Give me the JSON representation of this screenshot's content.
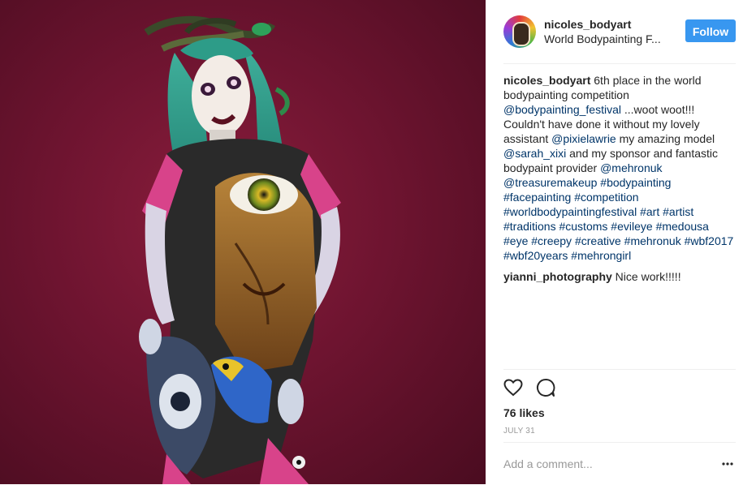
{
  "post": {
    "image_alt": "Bodypainted model with Medusa-style snake hair"
  },
  "header": {
    "username": "nicoles_bodyart",
    "location": "World Bodypainting F...",
    "follow_label": "Follow",
    "avatar_icon": "profile-avatar"
  },
  "comments": [
    {
      "user": "nicoles_bodyart",
      "segments": [
        {
          "text": " 6th place in the world bodypainting competition ",
          "type": "text"
        },
        {
          "text": "@bodypainting_festival",
          "type": "mention"
        },
        {
          "text": " ...woot woot!!! Couldn't have done it without my lovely assistant ",
          "type": "text"
        },
        {
          "text": "@pixielawrie",
          "type": "mention"
        },
        {
          "text": " my amazing model ",
          "type": "text"
        },
        {
          "text": "@sarah_xixi",
          "type": "mention"
        },
        {
          "text": " and my sponsor and fantastic bodypaint provider ",
          "type": "text"
        },
        {
          "text": "@mehronuk",
          "type": "mention"
        },
        {
          "text": " ",
          "type": "text"
        },
        {
          "text": "@treasuremakeup",
          "type": "mention"
        },
        {
          "text": " ",
          "type": "text"
        },
        {
          "text": "#bodypainting",
          "type": "mention"
        },
        {
          "text": " ",
          "type": "text"
        },
        {
          "text": "#facepainting",
          "type": "mention"
        },
        {
          "text": " ",
          "type": "text"
        },
        {
          "text": "#competition",
          "type": "mention"
        },
        {
          "text": " ",
          "type": "text"
        },
        {
          "text": "#worldbodypaintingfestival",
          "type": "mention"
        },
        {
          "text": " ",
          "type": "text"
        },
        {
          "text": "#art",
          "type": "mention"
        },
        {
          "text": " ",
          "type": "text"
        },
        {
          "text": "#artist",
          "type": "mention"
        },
        {
          "text": " ",
          "type": "text"
        },
        {
          "text": "#traditions",
          "type": "mention"
        },
        {
          "text": " ",
          "type": "text"
        },
        {
          "text": "#customs",
          "type": "mention"
        },
        {
          "text": " ",
          "type": "text"
        },
        {
          "text": "#evileye",
          "type": "mention"
        },
        {
          "text": " ",
          "type": "text"
        },
        {
          "text": "#medousa",
          "type": "mention"
        },
        {
          "text": " ",
          "type": "text"
        },
        {
          "text": "#eye",
          "type": "mention"
        },
        {
          "text": " ",
          "type": "text"
        },
        {
          "text": "#creepy",
          "type": "mention"
        },
        {
          "text": " ",
          "type": "text"
        },
        {
          "text": "#creative",
          "type": "mention"
        },
        {
          "text": " ",
          "type": "text"
        },
        {
          "text": "#mehronuk",
          "type": "mention"
        },
        {
          "text": " ",
          "type": "text"
        },
        {
          "text": "#wbf2017",
          "type": "mention"
        },
        {
          "text": " ",
          "type": "text"
        },
        {
          "text": "#wbf20years",
          "type": "mention"
        },
        {
          "text": " ",
          "type": "text"
        },
        {
          "text": "#mehrongirl",
          "type": "mention"
        }
      ]
    },
    {
      "user": "yianni_photography",
      "segments": [
        {
          "text": " Nice work!!!!!",
          "type": "text"
        }
      ]
    }
  ],
  "actions": {
    "like_icon": "heart-icon",
    "comment_icon": "comment-icon",
    "likes_text": "76 likes",
    "date": "JULY 31"
  },
  "add_comment": {
    "placeholder": "Add a comment...",
    "more_icon": "more-options-icon"
  },
  "colors": {
    "accent": "#3897f0",
    "mention": "#003569",
    "text": "#262626",
    "muted": "#999999",
    "divider": "#efefef",
    "photo_background": "#6e1430"
  }
}
